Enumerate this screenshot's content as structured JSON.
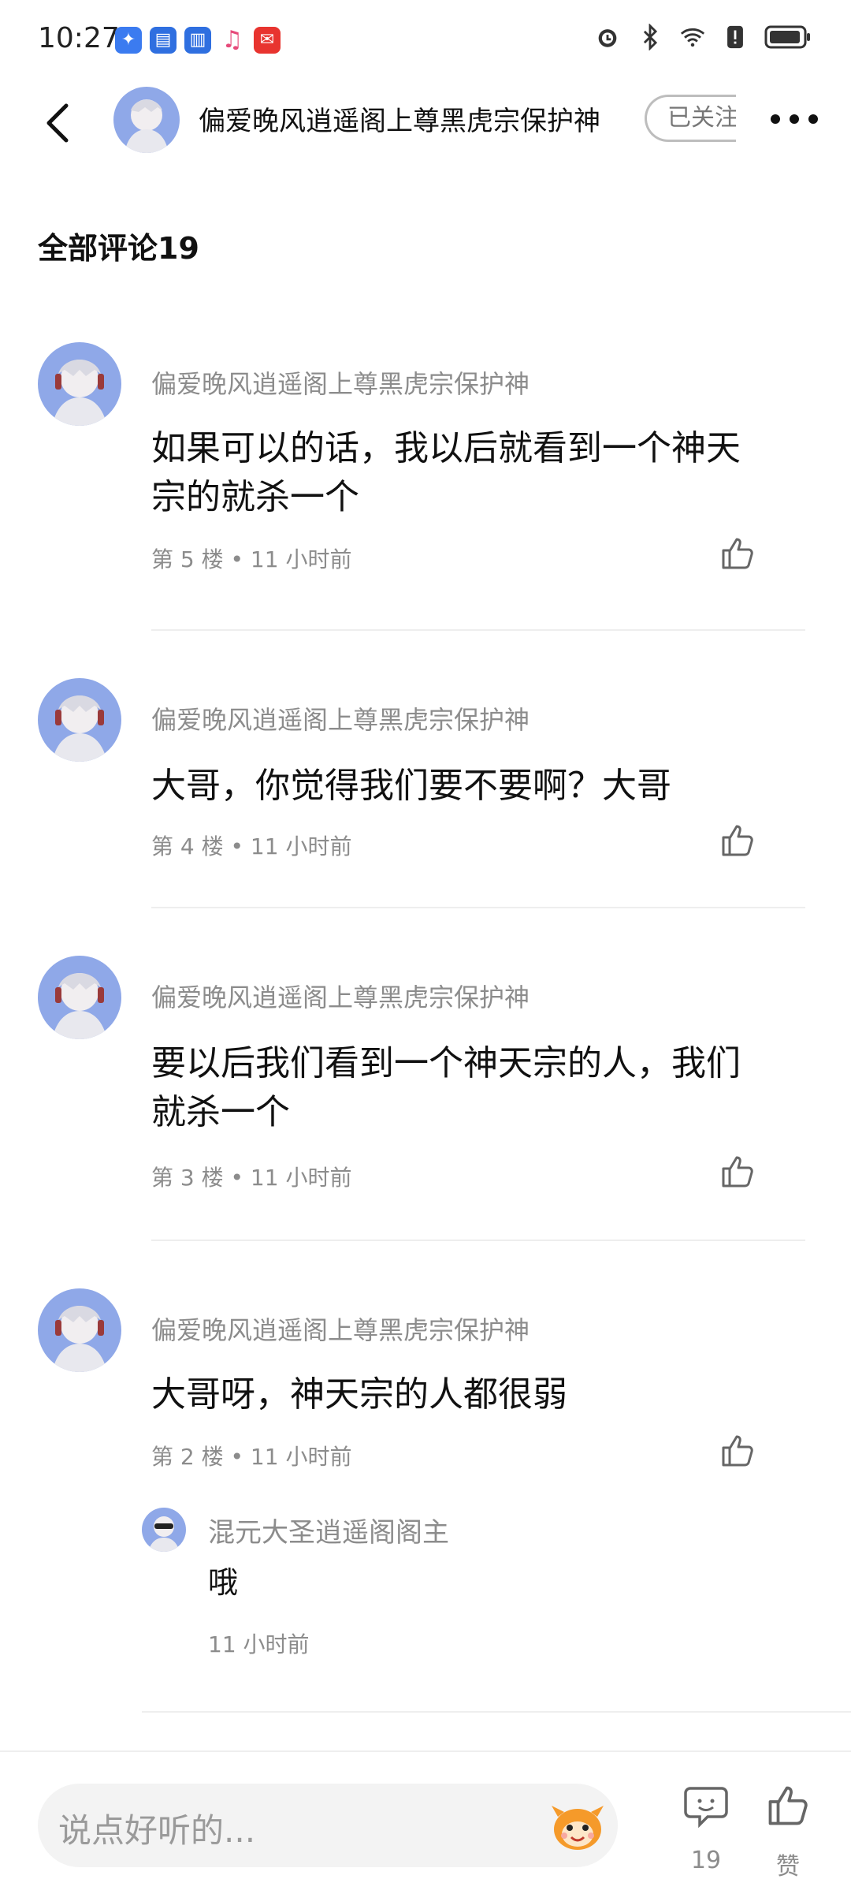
{
  "status_bar": {
    "time": "10:27",
    "app_icons": [
      "wing-app-icon",
      "document-app-icon",
      "document-app-icon-2",
      "music-note-icon",
      "mail-app-icon"
    ],
    "system_icons": [
      "alarm-icon",
      "bluetooth-icon",
      "wifi-icon",
      "battery-icon"
    ]
  },
  "header": {
    "name": "偏爱晚风逍遥阁上尊黑虎宗保护神",
    "follow_label": "已关注"
  },
  "comments_section": {
    "title": "全部评论19"
  },
  "comments": [
    {
      "author": "偏爱晚风逍遥阁上尊黑虎宗保护神",
      "text": "如果可以的话，我以后就看到一个神天宗的就杀一个",
      "meta": "第 5 楼 • 11 小时前"
    },
    {
      "author": "偏爱晚风逍遥阁上尊黑虎宗保护神",
      "text": "大哥，你觉得我们要不要啊？大哥",
      "meta": "第 4 楼 • 11 小时前"
    },
    {
      "author": "偏爱晚风逍遥阁上尊黑虎宗保护神",
      "text": "要以后我们看到一个神天宗的人，我们就杀一个",
      "meta": "第 3 楼 • 11 小时前"
    },
    {
      "author": "偏爱晚风逍遥阁上尊黑虎宗保护神",
      "text": "大哥呀，神天宗的人都很弱",
      "meta": "第 2 楼 • 11 小时前"
    }
  ],
  "reply": {
    "author": "混元大圣逍遥阁阁主",
    "text": "哦",
    "time": "11 小时前"
  },
  "bottom_bar": {
    "input_placeholder": "说点好听的...",
    "comment_count": "19",
    "like_label": "赞"
  },
  "colors": {
    "text_primary": "#111111",
    "text_secondary": "#8c8c8c",
    "divider": "#eeeeee",
    "input_bg": "#f3f3f3"
  }
}
